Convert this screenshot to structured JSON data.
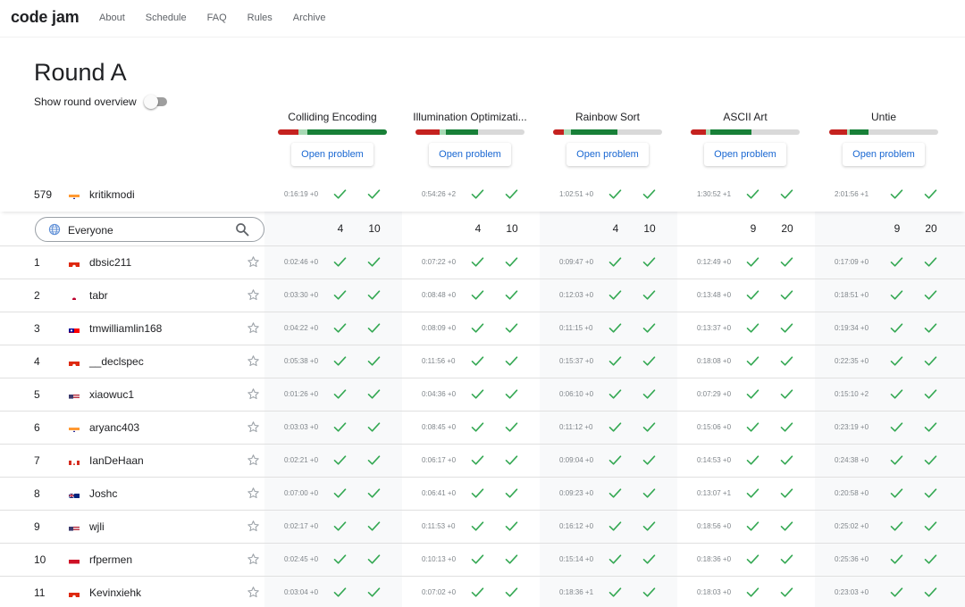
{
  "nav": {
    "logo": "code jam",
    "links": [
      "About",
      "Schedule",
      "FAQ",
      "Rules",
      "Archive"
    ]
  },
  "page": {
    "title": "Round A",
    "overview_label": "Show round overview",
    "overview_enabled": false
  },
  "problems": [
    {
      "name": "Colliding Encoding",
      "button": "Open problem",
      "bar": {
        "red": 0.19,
        "light": 0.08,
        "green": 0.73
      },
      "count_small": "4",
      "count_large": "10"
    },
    {
      "name": "Illumination Optimizati...",
      "button": "Open problem",
      "bar": {
        "red": 0.22,
        "light": 0.06,
        "green": 0.29
      },
      "count_small": "4",
      "count_large": "10"
    },
    {
      "name": "Rainbow Sort",
      "button": "Open problem",
      "bar": {
        "red": 0.1,
        "light": 0.06,
        "green": 0.43
      },
      "count_small": "4",
      "count_large": "10"
    },
    {
      "name": "ASCII Art",
      "button": "Open problem",
      "bar": {
        "red": 0.14,
        "light": 0.04,
        "green": 0.38
      },
      "count_small": "9",
      "count_large": "20"
    },
    {
      "name": "Untie",
      "button": "Open problem",
      "bar": {
        "red": 0.16,
        "light": 0.03,
        "green": 0.17
      },
      "count_small": "9",
      "count_large": "20"
    }
  ],
  "colors": {
    "bar_red": "#c5221f",
    "bar_light": "#a8dab5",
    "bar_green": "#188038",
    "bar_empty": "#d9d9d9",
    "check": "#34a853",
    "link": "#1967d2"
  },
  "current_user": {
    "rank": "579",
    "flag": "in",
    "username": "kritikmodi",
    "times": [
      "0:16:19 +0",
      "0:54:26 +2",
      "1:02:51 +0",
      "1:30:52 +1",
      "2:01:56 +1"
    ]
  },
  "filter": {
    "icon": "globe-icon",
    "value": "Everyone",
    "search_icon": "search-icon"
  },
  "rows": [
    {
      "rank": "1",
      "flag": "hk",
      "username": "dbsic211",
      "times": [
        "0:02:46 +0",
        "0:07:22 +0",
        "0:09:47 +0",
        "0:12:49 +0",
        "0:17:09 +0"
      ]
    },
    {
      "rank": "2",
      "flag": "jp",
      "username": "tabr",
      "times": [
        "0:03:30 +0",
        "0:08:48 +0",
        "0:12:03 +0",
        "0:13:48 +0",
        "0:18:51 +0"
      ]
    },
    {
      "rank": "3",
      "flag": "tw",
      "username": "tmwilliamlin168",
      "times": [
        "0:04:22 +0",
        "0:08:09 +0",
        "0:11:15 +0",
        "0:13:37 +0",
        "0:19:34 +0"
      ]
    },
    {
      "rank": "4",
      "flag": "hk",
      "username": "__declspec",
      "times": [
        "0:05:38 +0",
        "0:11:56 +0",
        "0:15:37 +0",
        "0:18:08 +0",
        "0:22:35 +0"
      ]
    },
    {
      "rank": "5",
      "flag": "us",
      "username": "xiaowuc1",
      "times": [
        "0:01:26 +0",
        "0:04:36 +0",
        "0:06:10 +0",
        "0:07:29 +0",
        "0:15:10 +2"
      ]
    },
    {
      "rank": "6",
      "flag": "in",
      "username": "aryanc403",
      "times": [
        "0:03:03 +0",
        "0:08:45 +0",
        "0:11:12 +0",
        "0:15:06 +0",
        "0:23:19 +0"
      ]
    },
    {
      "rank": "7",
      "flag": "ca",
      "username": "IanDeHaan",
      "times": [
        "0:02:21 +0",
        "0:06:17 +0",
        "0:09:04 +0",
        "0:14:53 +0",
        "0:24:38 +0"
      ]
    },
    {
      "rank": "8",
      "flag": "au",
      "username": "Joshc",
      "times": [
        "0:07:00 +0",
        "0:06:41 +0",
        "0:09:23 +0",
        "0:13:07 +1",
        "0:20:58 +0"
      ]
    },
    {
      "rank": "9",
      "flag": "us",
      "username": "wjli",
      "times": [
        "0:02:17 +0",
        "0:11:53 +0",
        "0:16:12 +0",
        "0:18:56 +0",
        "0:25:02 +0"
      ]
    },
    {
      "rank": "10",
      "flag": "id",
      "username": "rfpermen",
      "times": [
        "0:02:45 +0",
        "0:10:13 +0",
        "0:15:14 +0",
        "0:18:36 +0",
        "0:25:36 +0"
      ]
    },
    {
      "rank": "11",
      "flag": "hk",
      "username": "Kevinxiehk",
      "times": [
        "0:03:04 +0",
        "0:07:02 +0",
        "0:18:36 +1",
        "0:18:03 +0",
        "0:23:03 +0"
      ]
    }
  ]
}
